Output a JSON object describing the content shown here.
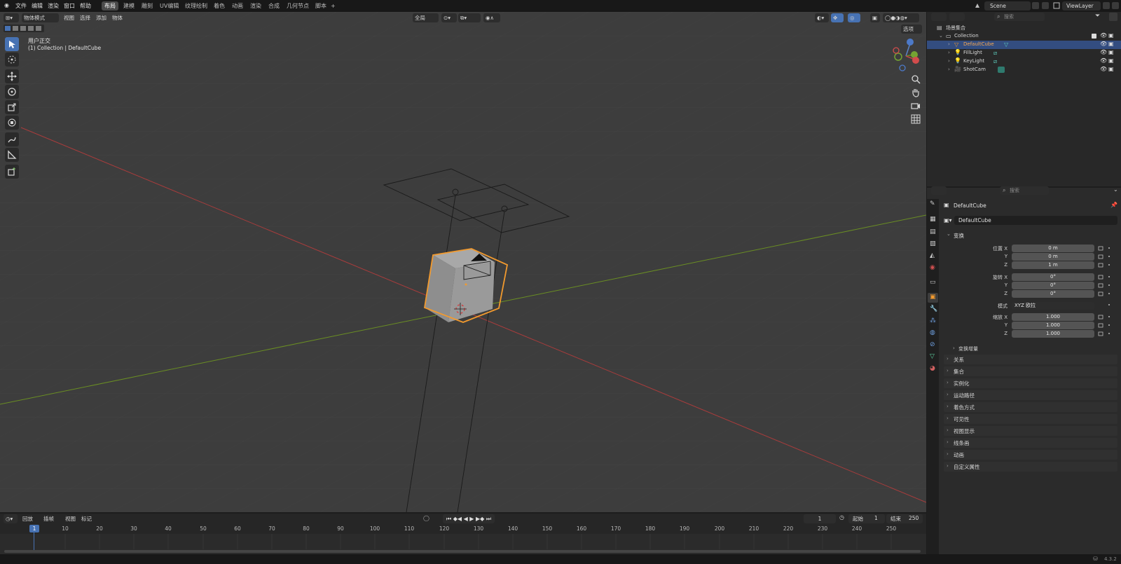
{
  "top_menu": {
    "items": [
      "文件",
      "编辑",
      "渲染",
      "窗口",
      "帮助"
    ],
    "workspaces": [
      "布局",
      "建模",
      "雕刻",
      "UV编辑",
      "纹理绘制",
      "着色",
      "动画",
      "渲染",
      "合成",
      "几何节点",
      "脚本"
    ],
    "add_tab": "+",
    "scene": "Scene",
    "view_layer": "ViewLayer"
  },
  "viewport": {
    "mode": "物体模式",
    "menus": [
      "视图",
      "选择",
      "添加",
      "物体"
    ],
    "transform_orientation": "全局",
    "options_label": "选项",
    "view_name": "用户正交",
    "context": "(1) Collection | DefaultCube"
  },
  "outliner": {
    "search_placeholder": "搜索",
    "root": "场景集合",
    "collection": "Collection",
    "objects": [
      "DefaultCube",
      "FillLight",
      "KeyLight",
      "ShotCam"
    ]
  },
  "properties": {
    "search_placeholder": "搜索",
    "object_name": "DefaultCube",
    "object_field": "DefaultCube",
    "transform_header": "变换",
    "location_label": "位置 X",
    "rotation_label": "旋转 X",
    "scale_label": "缩放 X",
    "y_label": "Y",
    "z_label": "Z",
    "location": [
      "0 m",
      "0 m",
      "1 m"
    ],
    "rotation": [
      "0°",
      "0°",
      "0°"
    ],
    "mode_label": "模式",
    "mode_value": "XYZ 欧拉",
    "scale": [
      "1.000",
      "1.000",
      "1.000"
    ],
    "delta_transform": "变换增量",
    "panels": [
      "关系",
      "集合",
      "实例化",
      "运动路径",
      "着色方式",
      "可见性",
      "视图显示",
      "线条画",
      "动画",
      "自定义属性"
    ]
  },
  "timeline": {
    "menus": [
      "回放",
      "插帧",
      "视图",
      "标记"
    ],
    "current_frame": "1",
    "start_label": "起始",
    "start": "1",
    "end_label": "结束",
    "end": "250",
    "ruler_current": "1",
    "ticks": [
      "10",
      "20",
      "30",
      "40",
      "50",
      "60",
      "70",
      "80",
      "90",
      "100",
      "110",
      "120",
      "130",
      "140",
      "150",
      "160",
      "170",
      "180",
      "190",
      "200",
      "210",
      "220",
      "230",
      "240",
      "250"
    ]
  },
  "status": {
    "version": "4.3.2"
  },
  "colors": {
    "selection": "#334d80",
    "accent": "#4772b3",
    "x_axis": "#b03a3a",
    "y_axis": "#6a8e23",
    "cube_outline": "#f29a2e"
  }
}
